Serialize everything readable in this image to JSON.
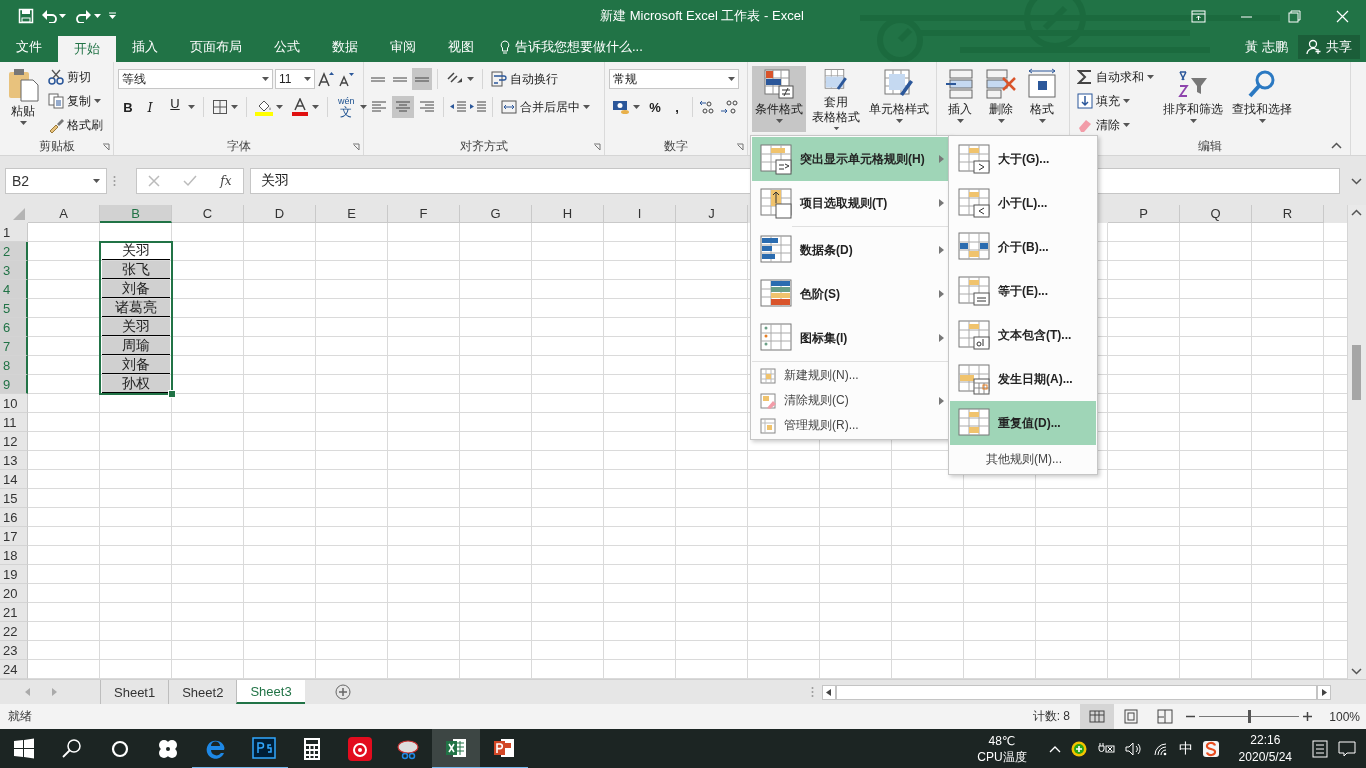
{
  "window": {
    "title": "新建 Microsoft Excel 工作表 - Excel"
  },
  "tabs": [
    {
      "label": "文件",
      "selected": false
    },
    {
      "label": "开始",
      "selected": true
    },
    {
      "label": "插入",
      "selected": false
    },
    {
      "label": "页面布局",
      "selected": false
    },
    {
      "label": "公式",
      "selected": false
    },
    {
      "label": "数据",
      "selected": false
    },
    {
      "label": "审阅",
      "selected": false
    },
    {
      "label": "视图",
      "selected": false
    }
  ],
  "tell_me": "告诉我您想要做什么...",
  "user": "黃 志鹏",
  "share": "共享",
  "ribbon": {
    "clipboard": {
      "label": "剪贴板",
      "paste": "粘贴",
      "cut": "剪切",
      "copy": "复制",
      "format_painter": "格式刷"
    },
    "font": {
      "label": "字体",
      "font_name": "等线",
      "font_size": "11",
      "bold": "B",
      "italic": "I",
      "underline": "U",
      "phonetic_top": "wén",
      "phonetic_bottom": "文"
    },
    "alignment": {
      "label": "对齐方式",
      "vertical": [
        {
          "selected": false
        },
        {
          "selected": false
        },
        {
          "selected": true
        }
      ],
      "horizontal": [
        {
          "selected": false
        },
        {
          "selected": true
        },
        {
          "selected": false
        }
      ],
      "wrap_text": "自动换行",
      "merge_center": "合并后居中"
    },
    "number": {
      "label": "数字",
      "format": "常规",
      "percent": "%",
      "comma": ","
    },
    "styles": {
      "conditional_formatting": {
        "label": "条件格式",
        "selected": true
      },
      "format_as_table": [
        "套用",
        "表格格式"
      ],
      "cell_styles": "单元格样式"
    },
    "cells": {
      "insert": "插入",
      "delete": "删除",
      "format": "格式"
    },
    "editing": {
      "label": "编辑",
      "autosum": "自动求和",
      "fill": "填充",
      "clear": "清除",
      "sort_filter": "排序和筛选",
      "find_select": "查找和选择"
    }
  },
  "formula_bar": {
    "name_box": "B2",
    "function_button": "fx",
    "formula": "关羽"
  },
  "grid": {
    "columns": [
      {
        "label": "A",
        "selected": false
      },
      {
        "label": "B",
        "selected": true
      },
      {
        "label": "C",
        "selected": false
      },
      {
        "label": "D",
        "selected": false
      },
      {
        "label": "E",
        "selected": false
      },
      {
        "label": "F",
        "selected": false
      },
      {
        "label": "G",
        "selected": false
      },
      {
        "label": "H",
        "selected": false
      },
      {
        "label": "I",
        "selected": false
      },
      {
        "label": "J",
        "selected": false
      },
      {
        "kind": "covered"
      },
      {
        "kind": "covered"
      },
      {
        "kind": "covered"
      },
      {
        "kind": "covered"
      },
      {
        "kind": "covered"
      },
      {
        "label": "P",
        "selected": false
      },
      {
        "label": "Q",
        "selected": false
      },
      {
        "label": "R",
        "selected": false
      }
    ],
    "rows": [
      {
        "label": "1",
        "selected": false
      },
      {
        "label": "2",
        "selected": true,
        "cells": [
          {
            "kind": "empty"
          },
          {
            "kind": "text",
            "text": "关羽",
            "highlighted": false
          }
        ]
      },
      {
        "label": "3",
        "selected": true,
        "cells": [
          {
            "kind": "empty"
          },
          {
            "kind": "text",
            "text": "张飞",
            "highlighted": true
          }
        ]
      },
      {
        "label": "4",
        "selected": true,
        "cells": [
          {
            "kind": "empty"
          },
          {
            "kind": "text",
            "text": "刘备",
            "highlighted": true
          }
        ]
      },
      {
        "label": "5",
        "selected": true,
        "cells": [
          {
            "kind": "empty"
          },
          {
            "kind": "text",
            "text": "诸葛亮",
            "highlighted": true
          }
        ]
      },
      {
        "label": "6",
        "selected": true,
        "cells": [
          {
            "kind": "empty"
          },
          {
            "kind": "text",
            "text": "关羽",
            "highlighted": true
          }
        ]
      },
      {
        "label": "7",
        "selected": true,
        "cells": [
          {
            "kind": "empty"
          },
          {
            "kind": "text",
            "text": "周瑜",
            "highlighted": true
          }
        ]
      },
      {
        "label": "8",
        "selected": true,
        "cells": [
          {
            "kind": "empty"
          },
          {
            "kind": "text",
            "text": "刘备",
            "highlighted": true
          }
        ]
      },
      {
        "label": "9",
        "selected": true,
        "cells": [
          {
            "kind": "empty"
          },
          {
            "kind": "text",
            "text": "孙权",
            "highlighted": true
          }
        ]
      },
      {
        "label": "10",
        "selected": false
      },
      {
        "label": "11",
        "selected": false
      },
      {
        "label": "12",
        "selected": false
      },
      {
        "label": "13",
        "selected": false
      },
      {
        "label": "14",
        "selected": false
      },
      {
        "label": "15",
        "selected": false
      },
      {
        "label": "16",
        "selected": false
      },
      {
        "label": "17",
        "selected": false
      },
      {
        "label": "18",
        "selected": false
      },
      {
        "label": "19",
        "selected": false
      },
      {
        "label": "20",
        "selected": false
      },
      {
        "label": "21",
        "selected": false
      },
      {
        "label": "22",
        "selected": false
      },
      {
        "label": "23",
        "selected": false
      },
      {
        "label": "24",
        "selected": false
      }
    ]
  },
  "conditional_menu": {
    "items": [
      {
        "kind": "large",
        "label": "突出显示单元格规则(H)",
        "selected": true,
        "has_submenu": true
      },
      {
        "kind": "large",
        "label": "项目选取规则(T)",
        "selected": false,
        "has_submenu": true
      },
      {
        "kind": "large",
        "label": "数据条(D)",
        "selected": false,
        "has_submenu": true
      },
      {
        "kind": "large",
        "label": "色阶(S)",
        "selected": false,
        "has_submenu": true
      },
      {
        "kind": "large",
        "label": "图标集(I)",
        "selected": false,
        "has_submenu": true
      },
      {
        "kind": "small",
        "label": "新建规则(N)...",
        "selected": false,
        "has_submenu": false
      },
      {
        "kind": "small",
        "label": "清除规则(C)",
        "selected": false,
        "has_submenu": true
      },
      {
        "kind": "small",
        "label": "管理规则(R)...",
        "selected": false,
        "has_submenu": false
      }
    ]
  },
  "submenu": {
    "items": [
      {
        "kind": "large",
        "label": "大于(G)...",
        "selected": false
      },
      {
        "kind": "large",
        "label": "小于(L)...",
        "selected": false
      },
      {
        "kind": "large",
        "label": "介于(B)...",
        "selected": false
      },
      {
        "kind": "large",
        "label": "等于(E)...",
        "selected": false
      },
      {
        "kind": "large",
        "label": "文本包含(T)...",
        "selected": false
      },
      {
        "kind": "large",
        "label": "发生日期(A)...",
        "selected": false
      },
      {
        "kind": "large",
        "label": "重复值(D)...",
        "selected": true
      },
      {
        "kind": "plain",
        "label": "其他规则(M)...",
        "selected": false
      }
    ]
  },
  "sheet_tabs": [
    {
      "label": "Sheet1",
      "selected": false
    },
    {
      "label": "Sheet2",
      "selected": false
    },
    {
      "label": "Sheet3",
      "selected": true
    }
  ],
  "status_bar": {
    "ready": "就绪",
    "count": "计数: 8",
    "views": [
      {
        "selected": true
      },
      {
        "selected": false
      },
      {
        "selected": false
      }
    ],
    "zoom": {
      "level": 0.5,
      "reading": "100%"
    }
  },
  "taskbar": {
    "apps": [
      {
        "running": false,
        "active": false
      },
      {
        "running": true,
        "active": false
      },
      {
        "running": true,
        "active": false
      },
      {
        "running": false,
        "active": false
      },
      {
        "running": false,
        "active": false
      },
      {
        "running": false,
        "active": false
      },
      {
        "running": true,
        "active": true
      },
      {
        "running": true,
        "active": false
      }
    ],
    "temperature": "48℃",
    "temperature_label": "CPU温度",
    "ime": "中",
    "time": "22:16",
    "date": "2020/5/24"
  }
}
